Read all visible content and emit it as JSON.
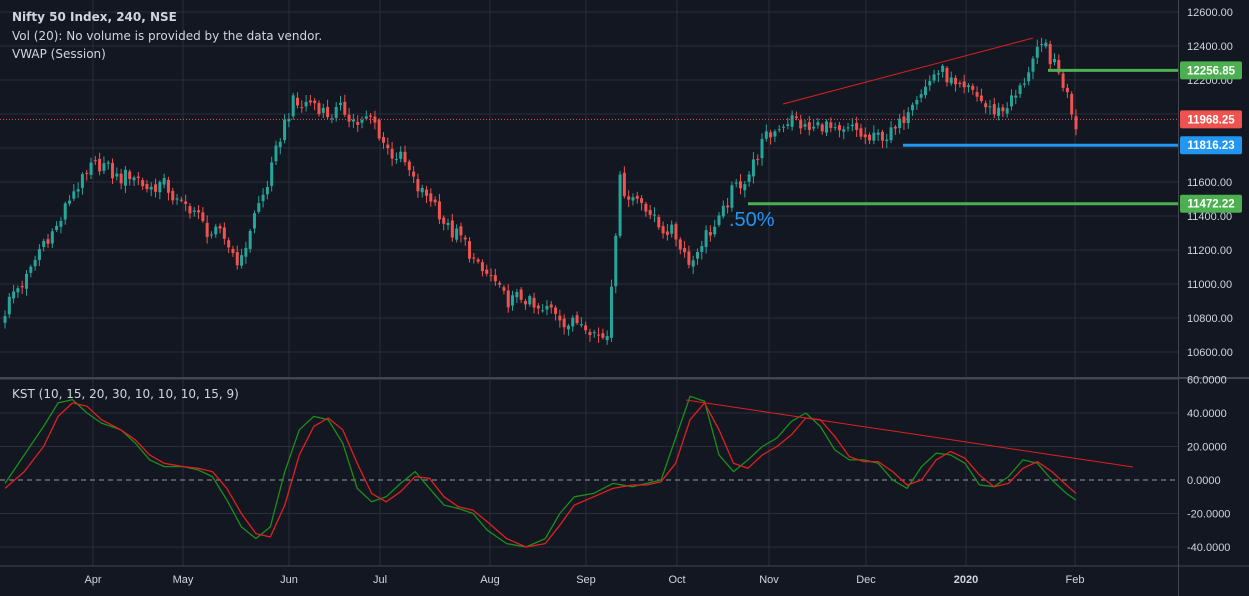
{
  "header": {
    "title": "Nifty 50 Index, 240, NSE",
    "volume_note": "Vol (20): No volume is provided by the data vendor.",
    "vwap_label": "VWAP (Session)",
    "kst_label": "KST (10, 15, 20, 30, 10, 10, 10, 15, 9)"
  },
  "colors": {
    "background": "#131722",
    "grid": "#2a2e39",
    "up": "#26a69a",
    "down": "#ef5350",
    "text": "#d1d4dc",
    "kst_line": "#1b8e1b",
    "kst_signal": "#e0201f",
    "trendline": "#e0201f",
    "level_green": "#4caf50",
    "level_blue": "#2196f3",
    "price_line": "#ef5350"
  },
  "chart_data": [
    {
      "type": "candlestick",
      "title": "Nifty 50 Index, 240, NSE",
      "ylim": [
        10500,
        12700
      ],
      "y_ticks": [
        "10600.00",
        "10800.00",
        "11000.00",
        "11200.00",
        "11400.00",
        "11600.00",
        "11800.00",
        "12000.00",
        "12200.00",
        "12400.00",
        "12600.00"
      ],
      "x_ticks": [
        "Apr",
        "May",
        "Jun",
        "Jul",
        "Aug",
        "Sep",
        "Oct",
        "Nov",
        "Dec",
        "2020",
        "Feb"
      ],
      "key_closes": [
        {
          "date": "Mar",
          "close": 10840
        },
        {
          "date": "Apr",
          "close": 11700
        },
        {
          "date": "May",
          "close": 11550
        },
        {
          "date": "May",
          "close": 11150
        },
        {
          "date": "Jun",
          "close": 12080
        },
        {
          "date": "Jul",
          "close": 11950
        },
        {
          "date": "Aug",
          "close": 10950
        },
        {
          "date": "Sep",
          "close": 10700
        },
        {
          "date": "Sep",
          "close": 11600
        },
        {
          "date": "Oct",
          "close": 11150
        },
        {
          "date": "Nov",
          "close": 11960
        },
        {
          "date": "Dec",
          "close": 11850
        },
        {
          "date": "Dec",
          "close": 12250
        },
        {
          "date": "2020",
          "close": 12000
        },
        {
          "date": "2020",
          "close": 12420
        },
        {
          "date": "Feb",
          "close": 11960
        }
      ],
      "price_labels": [
        {
          "value": 12256.85,
          "text": "12256.85",
          "color": "#4caf50"
        },
        {
          "value": 11968.25,
          "text": "11968.25",
          "color": "#ef5350"
        },
        {
          "value": 11816.23,
          "text": "11816.23",
          "color": "#2196f3"
        },
        {
          "value": 11472.22,
          "text": "11472.22",
          "color": "#4caf50"
        }
      ],
      "annotation": ".50%",
      "last_price": 11968.25
    },
    {
      "type": "line",
      "title": "KST (10, 15, 20, 30, 10, 10, 10, 15, 9)",
      "ylim": [
        -50,
        60
      ],
      "y_ticks": [
        "60.0000",
        "40.0000",
        "20.0000",
        "0.0000",
        "-20.0000",
        "-40.0000"
      ],
      "zero_line": true,
      "series": [
        {
          "values": [
            [
              0,
              -2
            ],
            [
              4,
              15
            ],
            [
              8,
              32
            ],
            [
              11,
              46
            ],
            [
              14,
              48
            ],
            [
              17,
              40
            ],
            [
              20,
              34
            ],
            [
              24,
              30
            ],
            [
              27,
              22
            ],
            [
              30,
              12
            ],
            [
              33,
              8
            ],
            [
              37,
              8
            ],
            [
              40,
              6
            ],
            [
              43,
              2
            ],
            [
              46,
              -12
            ],
            [
              49,
              -28
            ],
            [
              52,
              -35
            ],
            [
              55,
              -28
            ],
            [
              58,
              5
            ],
            [
              61,
              30
            ],
            [
              64,
              38
            ],
            [
              67,
              36
            ],
            [
              70,
              22
            ],
            [
              73,
              -5
            ],
            [
              76,
              -13
            ],
            [
              79,
              -10
            ],
            [
              82,
              -2
            ],
            [
              85,
              5
            ],
            [
              88,
              -5
            ],
            [
              91,
              -15
            ],
            [
              94,
              -17
            ],
            [
              97,
              -20
            ],
            [
              100,
              -30
            ],
            [
              104,
              -38
            ],
            [
              108,
              -40
            ],
            [
              112,
              -35
            ],
            [
              115,
              -20
            ],
            [
              118,
              -10
            ],
            [
              122,
              -8
            ],
            [
              126,
              -2
            ],
            [
              130,
              -4
            ],
            [
              133,
              -2
            ],
            [
              136,
              0
            ],
            [
              139,
              25
            ],
            [
              142,
              50
            ],
            [
              145,
              47
            ],
            [
              148,
              15
            ],
            [
              151,
              5
            ],
            [
              154,
              12
            ],
            [
              157,
              20
            ],
            [
              160,
              25
            ],
            [
              163,
              35
            ],
            [
              166,
              40
            ],
            [
              169,
              32
            ],
            [
              172,
              18
            ],
            [
              175,
              12
            ],
            [
              178,
              12
            ],
            [
              181,
              10
            ],
            [
              184,
              0
            ],
            [
              187,
              -5
            ],
            [
              190,
              8
            ],
            [
              193,
              16
            ],
            [
              196,
              15
            ],
            [
              199,
              10
            ],
            [
              202,
              -3
            ],
            [
              205,
              -4
            ],
            [
              208,
              2
            ],
            [
              211,
              12
            ],
            [
              214,
              10
            ],
            [
              217,
              0
            ],
            [
              220,
              -8
            ],
            [
              222,
              -12
            ]
          ]
        },
        {
          "values": [
            [
              0,
              -5
            ],
            [
              4,
              5
            ],
            [
              8,
              20
            ],
            [
              11,
              38
            ],
            [
              14,
              46
            ],
            [
              17,
              44
            ],
            [
              20,
              36
            ],
            [
              24,
              30
            ],
            [
              27,
              24
            ],
            [
              30,
              15
            ],
            [
              33,
              10
            ],
            [
              37,
              8
            ],
            [
              40,
              7
            ],
            [
              43,
              5
            ],
            [
              46,
              -5
            ],
            [
              49,
              -20
            ],
            [
              52,
              -32
            ],
            [
              55,
              -34
            ],
            [
              58,
              -15
            ],
            [
              61,
              15
            ],
            [
              64,
              32
            ],
            [
              67,
              37
            ],
            [
              70,
              30
            ],
            [
              73,
              10
            ],
            [
              76,
              -8
            ],
            [
              79,
              -13
            ],
            [
              82,
              -7
            ],
            [
              85,
              2
            ],
            [
              88,
              1
            ],
            [
              91,
              -10
            ],
            [
              94,
              -16
            ],
            [
              97,
              -18
            ],
            [
              100,
              -25
            ],
            [
              104,
              -35
            ],
            [
              108,
              -40
            ],
            [
              112,
              -38
            ],
            [
              115,
              -27
            ],
            [
              118,
              -15
            ],
            [
              122,
              -10
            ],
            [
              126,
              -5
            ],
            [
              130,
              -3
            ],
            [
              133,
              -3
            ],
            [
              136,
              -1
            ],
            [
              139,
              10
            ],
            [
              142,
              36
            ],
            [
              145,
              46
            ],
            [
              148,
              30
            ],
            [
              151,
              10
            ],
            [
              154,
              7
            ],
            [
              157,
              15
            ],
            [
              160,
              20
            ],
            [
              163,
              27
            ],
            [
              166,
              37
            ],
            [
              169,
              36
            ],
            [
              172,
              26
            ],
            [
              175,
              14
            ],
            [
              178,
              11
            ],
            [
              181,
              11
            ],
            [
              184,
              5
            ],
            [
              187,
              -3
            ],
            [
              190,
              0
            ],
            [
              193,
              12
            ],
            [
              196,
              17
            ],
            [
              199,
              13
            ],
            [
              202,
              3
            ],
            [
              205,
              -4
            ],
            [
              208,
              -2
            ],
            [
              211,
              7
            ],
            [
              214,
              11
            ],
            [
              217,
              5
            ],
            [
              220,
              -3
            ],
            [
              222,
              -8
            ]
          ]
        }
      ]
    }
  ]
}
